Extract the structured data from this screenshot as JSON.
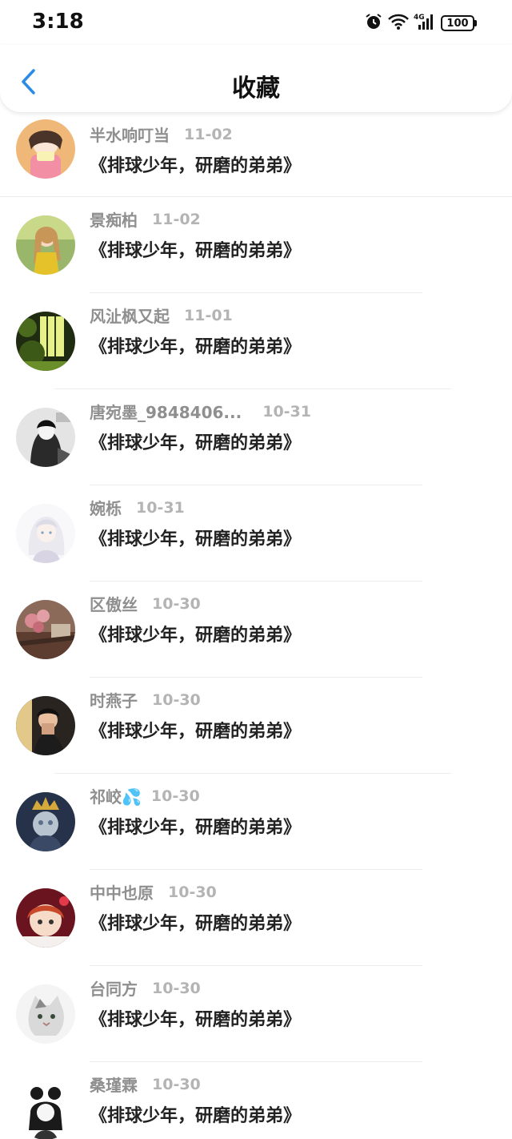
{
  "status_bar": {
    "time": "3:18",
    "battery": "100",
    "network": "4G"
  },
  "header": {
    "title": "收藏",
    "back_icon": "chevron-left-icon"
  },
  "colors": {
    "accent": "#2a8ce6",
    "name": "#8f8f8f",
    "date": "#b4b4b4"
  },
  "items": [
    {
      "name": "半水响叮当",
      "date": "11-02",
      "content": "《排球少年，研磨的弟弟》"
    },
    {
      "name": "景痴柏",
      "date": "11-02",
      "content": "《排球少年，研磨的弟弟》"
    },
    {
      "name": "风沚枫又起",
      "date": "11-01",
      "content": "《排球少年，研磨的弟弟》"
    },
    {
      "name": "唐宛墨_9848406...",
      "date": "10-31",
      "content": "《排球少年，研磨的弟弟》"
    },
    {
      "name": "婉栎",
      "date": "10-31",
      "content": "《排球少年，研磨的弟弟》"
    },
    {
      "name": "区傲丝",
      "date": "10-30",
      "content": "《排球少年，研磨的弟弟》"
    },
    {
      "name": "时燕子",
      "date": "10-30",
      "content": "《排球少年，研磨的弟弟》"
    },
    {
      "name": "祁峧💦",
      "date": "10-30",
      "content": "《排球少年，研磨的弟弟》"
    },
    {
      "name": "中中也原",
      "date": "10-30",
      "content": "《排球少年，研磨的弟弟》"
    },
    {
      "name": "台同方",
      "date": "10-30",
      "content": "《排球少年，研磨的弟弟》"
    },
    {
      "name": "桑瑾霖",
      "date": "10-30",
      "content": "《排球少年，研磨的弟弟》"
    }
  ]
}
